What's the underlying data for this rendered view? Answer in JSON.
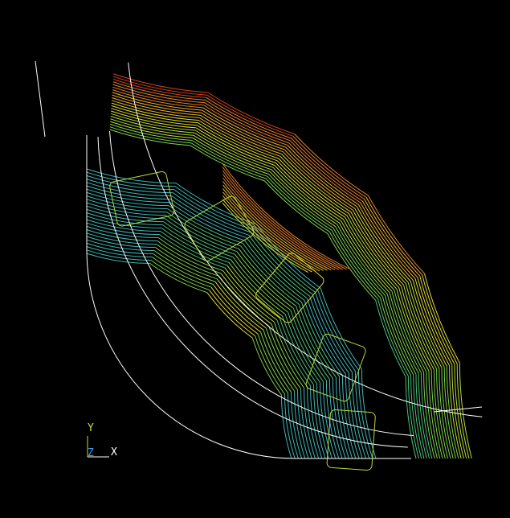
{
  "triad": {
    "y_label": "Y",
    "z_label": "Z",
    "x_label": "X",
    "colors": {
      "y": "#c8e020",
      "z": "#30a0ff",
      "x": "#ffffff"
    }
  },
  "palette": {
    "background": "#000000",
    "outline": "#ffffff",
    "contour_colors": [
      "#1e3cff",
      "#2f8fe8",
      "#3fb8b8",
      "#4ec07a",
      "#7ed04e",
      "#b8dc3a",
      "#e2dc2a",
      "#f0b42a",
      "#e8802a",
      "#d0401e"
    ]
  }
}
